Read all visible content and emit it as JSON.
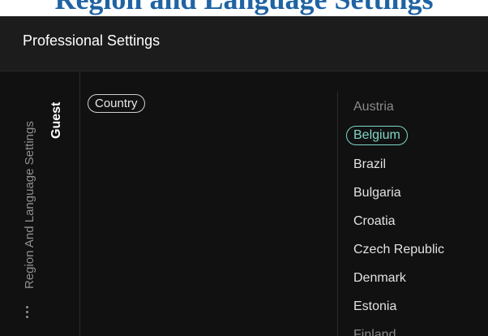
{
  "banner": {
    "partial_text": "Region and Language Settings"
  },
  "header": {
    "title": "Professional Settings"
  },
  "breadcrumb": {
    "parent": "Region And Language Settings",
    "current": "Guest"
  },
  "menu": {
    "country_label": "Country"
  },
  "countries": {
    "items": [
      "Austria",
      "Belgium",
      "Brazil",
      "Bulgaria",
      "Croatia",
      "Czech Republic",
      "Denmark",
      "Estonia",
      "Finland"
    ],
    "selected": "Belgium"
  },
  "colors": {
    "background": "#111111",
    "header": "#1c1c1c",
    "accent": "#7fd6c8",
    "banner_text": "#1f63a3"
  },
  "icons": {
    "more": "vertical-dots-icon"
  }
}
